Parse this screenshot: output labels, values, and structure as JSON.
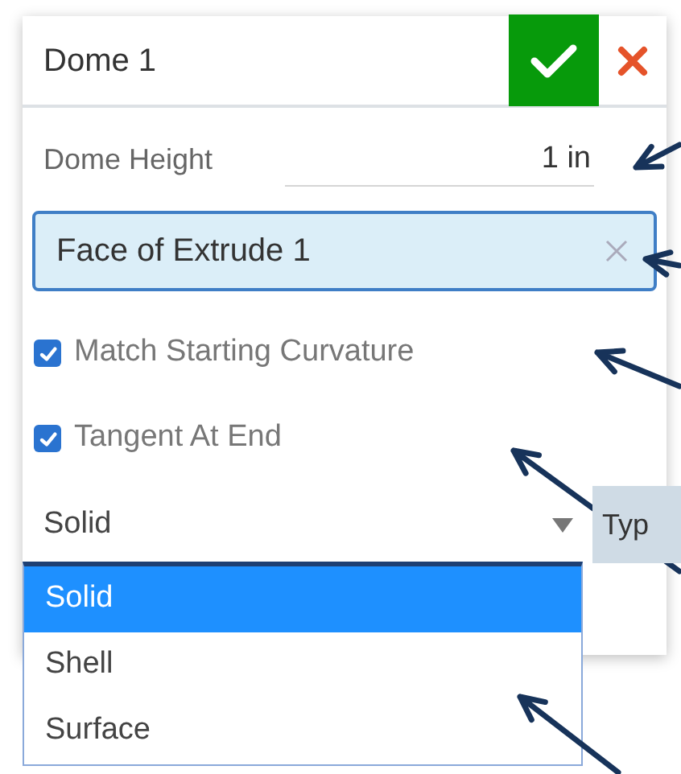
{
  "dialog": {
    "title": "Dome 1"
  },
  "dome_height": {
    "label": "Dome Height",
    "value": "1 in"
  },
  "selection_field": {
    "value": "Face of Extrude 1"
  },
  "options": [
    {
      "label": "Match Starting Curvature",
      "checked": true
    },
    {
      "label": "Tangent At End",
      "checked": true
    }
  ],
  "type_dropdown": {
    "value": "Solid",
    "expanded": true,
    "tag": "Typ",
    "items": [
      {
        "label": "Solid",
        "selected": true
      },
      {
        "label": "Shell",
        "selected": false
      },
      {
        "label": "Surface",
        "selected": false
      }
    ]
  }
}
